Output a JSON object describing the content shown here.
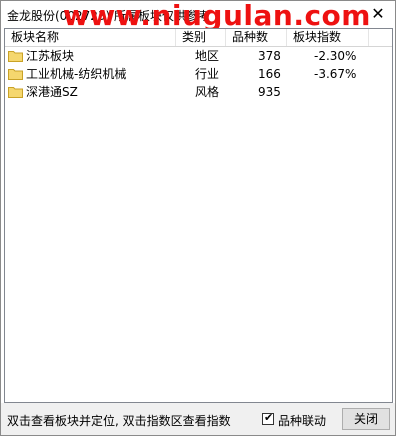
{
  "window": {
    "title": "金龙股份(002723) 所属板块仅供参考",
    "watermark": "www.niugulan.com",
    "close_glyph": "✕"
  },
  "table": {
    "columns": [
      "板块名称",
      "类别",
      "品种数",
      "板块指数"
    ],
    "rows": [
      {
        "name": "江苏板块",
        "category": "地区",
        "count": "378",
        "index": "-2.30%",
        "icon": "folder-icon"
      },
      {
        "name": "工业机械-纺织机械",
        "category": "行业",
        "count": "166",
        "index": "-3.67%",
        "icon": "folder-icon"
      },
      {
        "name": "深港通SZ",
        "category": "风格",
        "count": "935",
        "index": "",
        "icon": "folder-icon"
      }
    ]
  },
  "footer": {
    "hint": "双击查看板块并定位, 双击指数区查看指数",
    "checkbox_label": "品种联动",
    "checkbox_checked": true,
    "close_button": "关闭"
  },
  "colors": {
    "watermark": "#ee1111",
    "folder_fill": "#f5d76e",
    "folder_stroke": "#c9a227",
    "statusbar": "#f0f0f0"
  }
}
